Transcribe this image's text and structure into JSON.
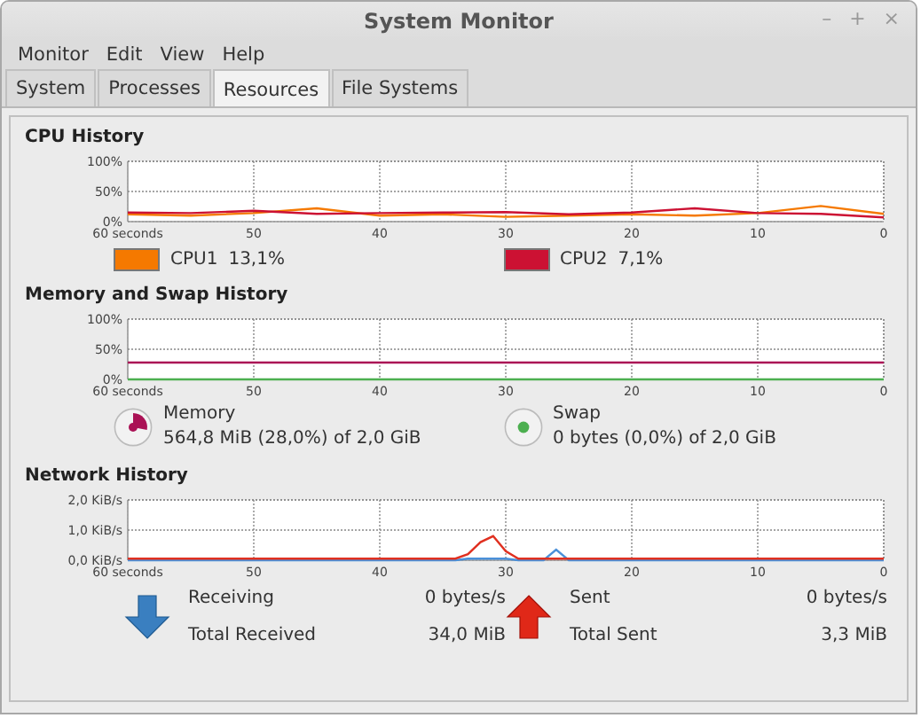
{
  "window": {
    "title": "System Monitor",
    "controls": [
      "–",
      "+",
      "×"
    ]
  },
  "menu": [
    "Monitor",
    "Edit",
    "View",
    "Help"
  ],
  "tabs": [
    {
      "label": "System",
      "selected": false
    },
    {
      "label": "Processes",
      "selected": false
    },
    {
      "label": "Resources",
      "selected": true
    },
    {
      "label": "File Systems",
      "selected": false
    }
  ],
  "sections": [
    {
      "kind": "cpu",
      "title": "CPU History",
      "chart_data": {
        "type": "line",
        "grid": true,
        "x": [
          60,
          55,
          50,
          45,
          40,
          35,
          30,
          25,
          20,
          15,
          10,
          5,
          0
        ],
        "xlim": [
          60,
          0
        ],
        "ylim": [
          0,
          100
        ],
        "yticks": [
          {
            "value": 0,
            "label": "0%"
          },
          {
            "value": 50,
            "label": "50%"
          },
          {
            "value": 100,
            "label": "100%"
          }
        ],
        "xticks": [
          {
            "value": 60,
            "label": "60 seconds"
          },
          {
            "value": 50,
            "label": "50"
          },
          {
            "value": 40,
            "label": "40"
          },
          {
            "value": 30,
            "label": "30"
          },
          {
            "value": 20,
            "label": "20"
          },
          {
            "value": 10,
            "label": "10"
          },
          {
            "value": 0,
            "label": "0"
          }
        ],
        "series": [
          {
            "name": "CPU1",
            "color": "#f57900",
            "values": [
              12,
              10,
              14,
              22,
              10,
              12,
              8,
              10,
              12,
              10,
              14,
              26,
              13
            ]
          },
          {
            "name": "CPU2",
            "color": "#cc1133",
            "values": [
              15,
              14,
              18,
              13,
              14,
              15,
              16,
              12,
              15,
              22,
              14,
              13,
              7
            ]
          }
        ]
      },
      "legend": [
        {
          "value": "13,1%"
        },
        {
          "value": "7,1%"
        }
      ]
    },
    {
      "kind": "memory",
      "title": "Memory and Swap History",
      "chart_data": {
        "type": "line",
        "grid": true,
        "x": [
          60,
          0
        ],
        "xlim": [
          60,
          0
        ],
        "ylim": [
          0,
          100
        ],
        "yticks": [
          {
            "value": 0,
            "label": "0%"
          },
          {
            "value": 50,
            "label": "50%"
          },
          {
            "value": 100,
            "label": "100%"
          }
        ],
        "xticks": [
          {
            "value": 60,
            "label": "60 seconds"
          },
          {
            "value": 50,
            "label": "50"
          },
          {
            "value": 40,
            "label": "40"
          },
          {
            "value": 30,
            "label": "30"
          },
          {
            "value": 20,
            "label": "20"
          },
          {
            "value": 10,
            "label": "10"
          },
          {
            "value": 0,
            "label": "0"
          }
        ],
        "series": [
          {
            "name": "Memory",
            "color": "#aa1155",
            "values": [
              28,
              28
            ]
          },
          {
            "name": "Swap",
            "color": "#4caf50",
            "values": [
              0,
              0
            ]
          }
        ]
      },
      "legend": [
        {
          "kind": "wedge",
          "detail": "564,8 MiB (28,0%) of 2,0 GiB"
        },
        {
          "kind": "dot",
          "detail": "0 bytes (0,0%) of 2,0 GiB"
        }
      ]
    },
    {
      "kind": "network",
      "title": "Network History",
      "chart_data": {
        "type": "line",
        "grid": true,
        "x": [
          60,
          50,
          40,
          34,
          33,
          32,
          31,
          30,
          29,
          28,
          27,
          26,
          25,
          20,
          10,
          0
        ],
        "xlim": [
          60,
          0
        ],
        "ylim": [
          0,
          2
        ],
        "yticks": [
          {
            "value": 0,
            "label": "0,0 KiB/s"
          },
          {
            "value": 1,
            "label": "1,0 KiB/s"
          },
          {
            "value": 2,
            "label": "2,0 KiB/s"
          }
        ],
        "xticks": [
          {
            "value": 60,
            "label": "60 seconds"
          },
          {
            "value": 50,
            "label": "50"
          },
          {
            "value": 40,
            "label": "40"
          },
          {
            "value": 30,
            "label": "30"
          },
          {
            "value": 20,
            "label": "20"
          },
          {
            "value": 10,
            "label": "10"
          },
          {
            "value": 0,
            "label": "0"
          }
        ],
        "series": [
          {
            "name": "Receiving",
            "color": "#4a90d9",
            "values": [
              0,
              0,
              0,
              0,
              0.05,
              0.05,
              0.05,
              0.05,
              0,
              0,
              0,
              0.35,
              0,
              0,
              0,
              0
            ]
          },
          {
            "name": "Sent",
            "color": "#e03020",
            "values": [
              0.05,
              0.05,
              0.05,
              0.05,
              0.2,
              0.6,
              0.8,
              0.3,
              0.05,
              0.05,
              0.05,
              0.05,
              0.05,
              0.05,
              0.05,
              0.05
            ]
          }
        ]
      },
      "legend": [
        {
          "kind": "receiving",
          "rate": "0 bytes/s",
          "total_label": "Total Received",
          "total": "34,0 MiB",
          "color": "#3a7fc0"
        },
        {
          "kind": "sent",
          "rate": "0 bytes/s",
          "total_label": "Total Sent",
          "total": "3,3 MiB",
          "color": "#e02818"
        }
      ]
    }
  ]
}
